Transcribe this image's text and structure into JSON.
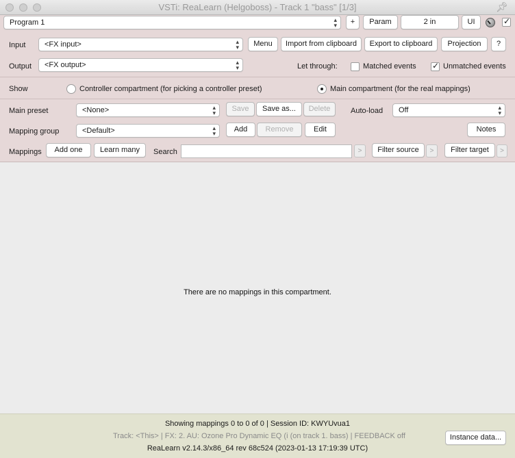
{
  "window": {
    "title": "VSTi: ReaLearn (Helgoboss) - Track 1 \"bass\" [1/3]"
  },
  "toolbar": {
    "program_value": "Program 1",
    "plus_label": "+",
    "param_label": "Param",
    "io_value": "2 in",
    "ui_label": "UI",
    "bypass_checked": true
  },
  "input_row": {
    "label": "Input",
    "value": "<FX input>",
    "menu_label": "Menu",
    "import_label": "Import from clipboard",
    "export_label": "Export to clipboard",
    "projection_label": "Projection",
    "help_label": "?"
  },
  "output_row": {
    "label": "Output",
    "value": "<FX output>",
    "let_through_label": "Let through:",
    "matched_label": "Matched events",
    "matched_checked": false,
    "unmatched_label": "Unmatched events",
    "unmatched_checked": true
  },
  "show_row": {
    "label": "Show",
    "controller_label": "Controller compartment (for picking a controller preset)",
    "main_label": "Main compartment (for the real mappings)",
    "selected": "main"
  },
  "preset_row": {
    "label": "Main preset",
    "value": "<None>",
    "save_label": "Save",
    "save_as_label": "Save as...",
    "delete_label": "Delete",
    "autoload_label": "Auto-load",
    "autoload_value": "Off"
  },
  "group_row": {
    "label": "Mapping group",
    "value": "<Default>",
    "add_label": "Add",
    "remove_label": "Remove",
    "edit_label": "Edit",
    "notes_label": "Notes"
  },
  "mappings_row": {
    "label": "Mappings",
    "add_one_label": "Add one",
    "learn_many_label": "Learn many",
    "search_label": "Search",
    "search_value": "",
    "filter_source_label": "Filter source",
    "filter_target_label": "Filter target",
    "small_arrow": ">"
  },
  "main": {
    "empty_message": "There are no mappings in this compartment."
  },
  "footer": {
    "showing": "Showing mappings 0 to 0 of 0 | Session ID: KWYUvua1",
    "track_info": "Track: <This> | FX: 2. AU: Ozone Pro Dynamic EQ (i (on track 1. bass) | FEEDBACK off",
    "version": "ReaLearn v2.14.3/x86_64 rev 68c524 (2023-01-13 17:19:39 UTC)",
    "instance_data_label": "Instance data..."
  },
  "colors": {
    "panel_pink": "#e6d8d8",
    "footer_bg": "#e2e3d0",
    "main_bg": "#ececec"
  },
  "icons": [
    "pin-icon",
    "knob-icon",
    "chevron-updown-icon",
    "checkmark-icon",
    "radio-dot-icon"
  ]
}
